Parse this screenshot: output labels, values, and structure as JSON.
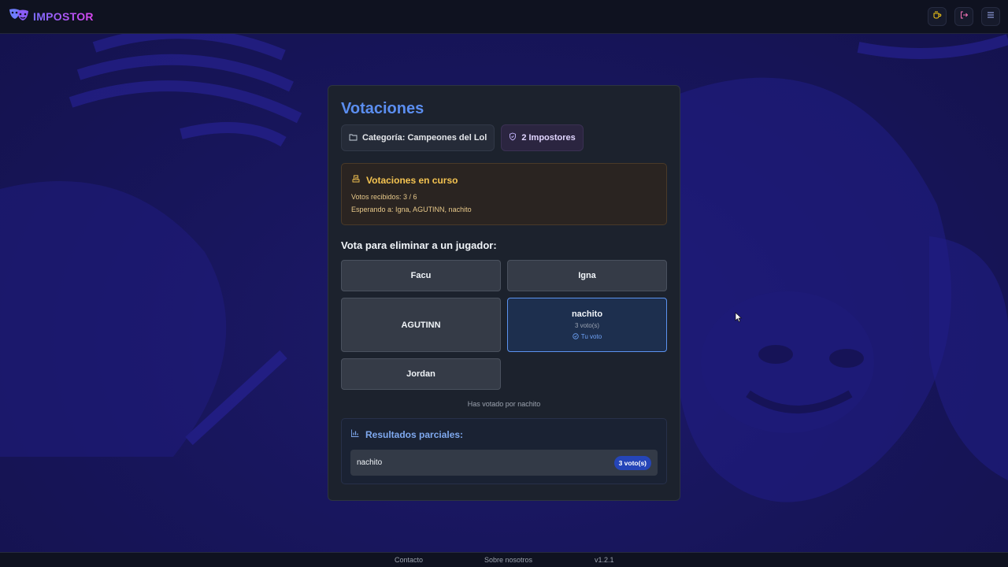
{
  "header": {
    "brand": "IMPOSTOR",
    "actions": [
      "coffee-icon",
      "logout-icon",
      "menu-icon"
    ]
  },
  "card": {
    "title": "Votaciones",
    "category_chip": "Categoría: Campeones del Lol",
    "impostors_chip": "2 Impostores",
    "status": {
      "title": "Votaciones en curso",
      "votes_received": "Votos recibidos: 3 / 6",
      "waiting": "Esperando a: Igna, AGUTINN, nachito"
    },
    "vote_heading": "Vota para eliminar a un jugador:",
    "players": [
      {
        "name": "Facu"
      },
      {
        "name": "Igna"
      },
      {
        "name": "AGUTINN"
      },
      {
        "name": "nachito",
        "votes": "3 voto(s)",
        "mine": "Tu voto"
      },
      {
        "name": "Jordan"
      }
    ],
    "voted_note": "Has votado por nachito",
    "results": {
      "title": "Resultados parciales:",
      "rows": [
        {
          "name": "nachito",
          "votes": "3 voto(s)"
        }
      ]
    }
  },
  "footer": {
    "contact": "Contacto",
    "about": "Sobre nosotros",
    "version": "v1.2.1"
  },
  "colors": {
    "accent": "#5b8ef0",
    "warning": "#f5c451",
    "brand": "#a855f7",
    "badge": "#2545b8"
  }
}
